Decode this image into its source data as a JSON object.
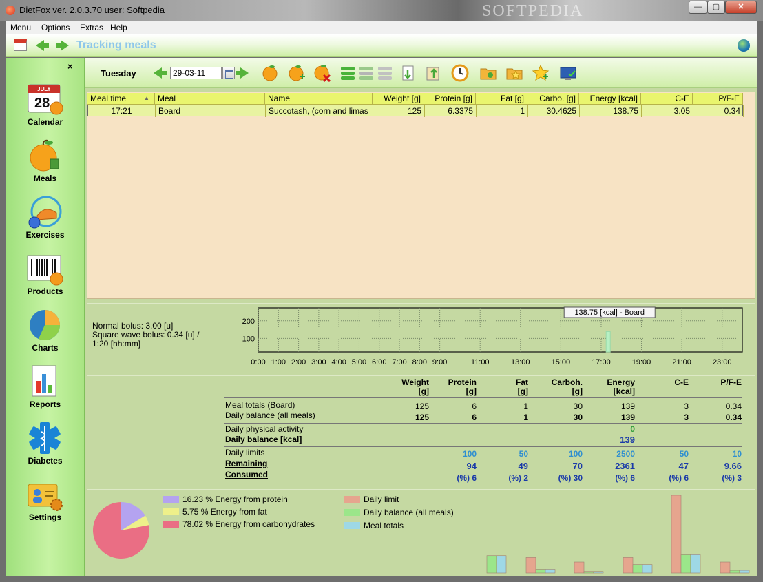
{
  "window": {
    "title": "DietFox  ver. 2.0.3.70  user: Softpedia",
    "watermark": "SOFTPEDIA",
    "minimize_label": "—",
    "maximize_label": "▢",
    "close_label": "✕"
  },
  "menu": {
    "items": [
      "Menu",
      "Options",
      "Extras",
      "Help"
    ]
  },
  "header": {
    "title": "Tracking meals"
  },
  "sidebar": {
    "close_label": "×",
    "items": [
      {
        "label": "Calendar",
        "icon": "calendar-icon",
        "badge_month": "JULY",
        "badge_day": "28"
      },
      {
        "label": "Meals",
        "icon": "orange-icon"
      },
      {
        "label": "Exercises",
        "icon": "exercise-icon"
      },
      {
        "label": "Products",
        "icon": "barcode-icon"
      },
      {
        "label": "Charts",
        "icon": "pie-chart-icon"
      },
      {
        "label": "Reports",
        "icon": "report-icon"
      },
      {
        "label": "Diabetes",
        "icon": "medical-star-icon"
      },
      {
        "label": "Settings",
        "icon": "settings-icon"
      }
    ]
  },
  "toolbar": {
    "day": "Tuesday",
    "date": "29-03-11",
    "icons": [
      "add-meal-icon",
      "add-product-icon",
      "delete-meal-icon",
      "list-expand-icon",
      "list-collapse-icon",
      "list-icon",
      "import-icon",
      "export-icon",
      "clock-icon",
      "folder-icon",
      "folder-star-icon",
      "favorite-star-icon",
      "monitor-icon"
    ]
  },
  "table": {
    "columns": [
      "Meal time",
      "Meal",
      "Name",
      "Weight [g]",
      "Protein [g]",
      "Fat [g]",
      "Carbo. [g]",
      "Energy [kcal]",
      "C-E",
      "P/F-E"
    ],
    "sort_indicator": "▲",
    "rows": [
      [
        "17:21",
        "Board",
        "Succotash, (corn and limas",
        "125",
        "6.3375",
        "1",
        "30.4625",
        "138.75",
        "3.05",
        "0.34"
      ]
    ]
  },
  "bolus": {
    "normal": "Normal bolus: 3.00 [u]",
    "square_line1": "Square wave bolus: 0.34 [u] /",
    "square_line2": "1:20 [hh:mm]"
  },
  "chart_data": [
    {
      "type": "bar",
      "x_ticks": [
        "0:00",
        "1:00",
        "2:00",
        "3:00",
        "4:00",
        "5:00",
        "6:00",
        "7:00",
        "8:00",
        "9:00",
        "11:00",
        "13:00",
        "15:00",
        "17:00",
        "19:00",
        "21:00",
        "23:00"
      ],
      "y_ticks": [
        "200",
        "100"
      ],
      "ylim": [
        0,
        250
      ],
      "points": [
        {
          "time": "17:21",
          "value": 138.75,
          "label": "Board"
        }
      ],
      "tooltip": "138.75 [kcal] - Board",
      "grid": true
    },
    {
      "type": "pie",
      "slices": [
        {
          "label": "16.23 % Energy from protein",
          "value": 16.23,
          "color": "#b4a3f0"
        },
        {
          "label": "5.75 % Energy from fat",
          "value": 5.75,
          "color": "#eef08a"
        },
        {
          "label": "78.02 % Energy from carbohydrates",
          "value": 78.02,
          "color": "#ea6e84"
        }
      ]
    },
    {
      "type": "bar",
      "categories": [
        "Weight",
        "Protein",
        "Fat",
        "Carboh.",
        "Energy",
        "C-E",
        "P/F-E"
      ],
      "series": [
        {
          "name": "Daily limit",
          "color": "#e6a58e",
          "values": [
            null,
            100,
            50,
            100,
            2500,
            50,
            10
          ]
        },
        {
          "name": "Daily balance (all meals)",
          "color": "#9be68a",
          "values": [
            125,
            6,
            1,
            30,
            139,
            3,
            0.34
          ]
        },
        {
          "name": "Meal totals",
          "color": "#9ed8e6",
          "values": [
            125,
            6,
            1,
            30,
            139,
            3,
            0.34
          ]
        }
      ]
    }
  ],
  "summary": {
    "headers": [
      [
        "Weight",
        "[g]"
      ],
      [
        "Protein",
        "[g]"
      ],
      [
        "Fat",
        "[g]"
      ],
      [
        "Carboh.",
        "[g]"
      ],
      [
        "Energy",
        "[kcal]"
      ],
      [
        "C-E",
        ""
      ],
      [
        "P/F-E",
        ""
      ]
    ],
    "meal_totals_label": "Meal totals (Board)",
    "meal_totals": [
      "125",
      "6",
      "1",
      "30",
      "139",
      "3",
      "0.34"
    ],
    "daily_balance_label": "Daily balance (all meals)",
    "daily_balance": [
      "125",
      "6",
      "1",
      "30",
      "139",
      "3",
      "0.34"
    ],
    "activity_label": "Daily physical activity",
    "activity_value": "0",
    "balance_kcal_label": "Daily balance [kcal]",
    "balance_kcal_value": "139",
    "limits_label": "Daily limits",
    "limits": [
      "100",
      "50",
      "100",
      "2500",
      "50",
      "10"
    ],
    "remaining_label": "Remaining",
    "remaining": [
      "94",
      "49",
      "70",
      "2361",
      "47",
      "9.66"
    ],
    "consumed_label": "Consumed",
    "consumed": [
      "(%) 6",
      "(%) 2",
      "(%) 30",
      "(%) 6",
      "(%) 6",
      "(%) 3"
    ]
  }
}
